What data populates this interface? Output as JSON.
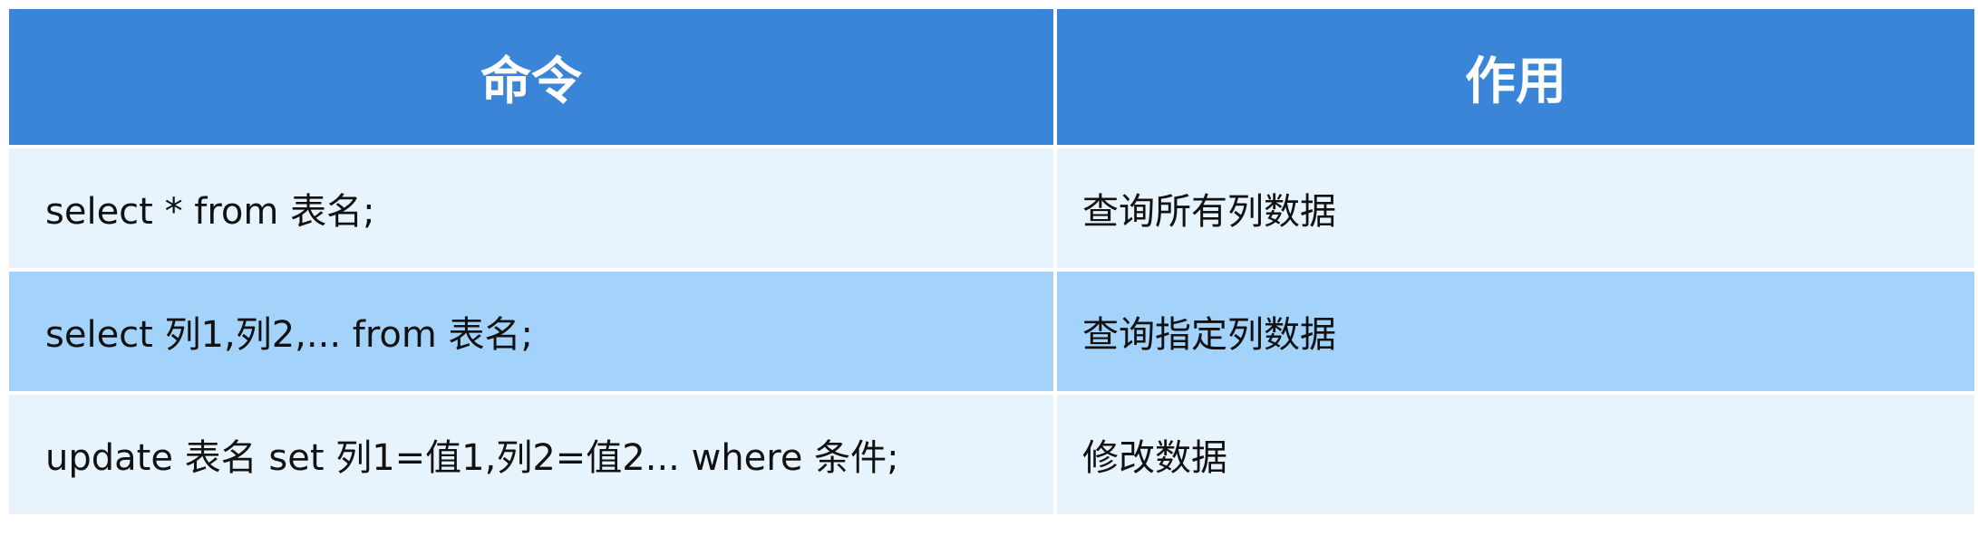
{
  "table": {
    "headers": [
      "命令",
      "作用"
    ],
    "rows": [
      {
        "command": "select * from 表名;",
        "purpose": "查询所有列数据"
      },
      {
        "command": "select 列1,列2,... from 表名;",
        "purpose": "查询指定列数据"
      },
      {
        "command": "update 表名 set 列1=值1,列2=值2... where 条件;",
        "purpose": "修改数据"
      }
    ]
  },
  "colors": {
    "header_bg": "#3a85d8",
    "header_text": "#ffffff",
    "row_light": "#e8f4fd",
    "row_highlight": "#a3d3fb"
  }
}
